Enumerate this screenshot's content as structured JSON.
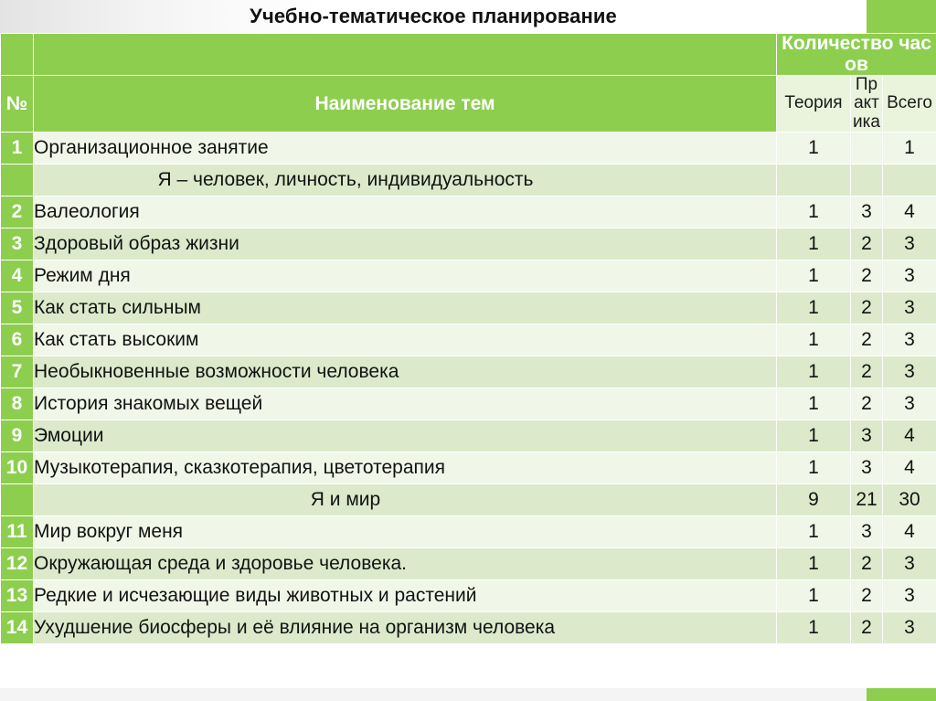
{
  "title": "Учебно-тематическое планирование",
  "table": {
    "headers": {
      "num": "№",
      "name": "Наименование тем",
      "qty_group": "Количество часов",
      "theory": "Теория",
      "practice": "Практика",
      "total": "Всего"
    },
    "rows": [
      {
        "kind": "data",
        "num": "1",
        "name": "Организационное занятие",
        "theory": "1",
        "practice": "",
        "total": "1"
      },
      {
        "kind": "section",
        "num": "",
        "name": "Я – человек, личность, индивидуальность",
        "theory": "",
        "practice": "",
        "total": ""
      },
      {
        "kind": "data",
        "num": "2",
        "name": "Валеология",
        "theory": "1",
        "practice": "3",
        "total": "4"
      },
      {
        "kind": "data",
        "num": "3",
        "name": "Здоровый образ жизни",
        "theory": "1",
        "practice": "2",
        "total": "3"
      },
      {
        "kind": "data",
        "num": "4",
        "name": "Режим дня",
        "theory": "1",
        "practice": "2",
        "total": "3"
      },
      {
        "kind": "data",
        "num": "5",
        "name": "Как стать сильным",
        "theory": "1",
        "practice": "2",
        "total": "3"
      },
      {
        "kind": "data",
        "num": "6",
        "name": "Как стать  высоким",
        "theory": "1",
        "practice": "2",
        "total": "3"
      },
      {
        "kind": "data",
        "num": "7",
        "name": "Необыкновенные возможности человека",
        "theory": "1",
        "practice": "2",
        "total": "3"
      },
      {
        "kind": "data",
        "num": "8",
        "name": "История знакомых вещей",
        "theory": "1",
        "practice": "2",
        "total": "3"
      },
      {
        "kind": "data",
        "num": "9",
        "name": "Эмоции",
        "theory": "1",
        "practice": "3",
        "total": "4"
      },
      {
        "kind": "data",
        "num": "10",
        "name": "Музыкотерапия, сказкотерапия, цветотерапия",
        "theory": "1",
        "practice": "3",
        "total": "4"
      },
      {
        "kind": "section",
        "num": "",
        "name": "Я и мир",
        "theory": "9",
        "practice": "21",
        "total": "30"
      },
      {
        "kind": "data",
        "num": "11",
        "name": "Мир вокруг меня",
        "theory": "1",
        "practice": "3",
        "total": "4"
      },
      {
        "kind": "data",
        "num": "12",
        "name": "Окружающая среда и здоровье человека.",
        "theory": "1",
        "practice": "2",
        "total": "3"
      },
      {
        "kind": "data",
        "num": "13",
        "name": "Редкие и исчезающие виды животных и растений",
        "theory": "1",
        "practice": "2",
        "total": "3"
      },
      {
        "kind": "data",
        "num": "14",
        "name": "Ухудшение биосферы и её влияние на организм человека",
        "theory": "1",
        "practice": "2",
        "total": "3"
      }
    ]
  },
  "colors": {
    "accent_green": "#8dce4f",
    "row_light": "#f1f7e8",
    "row_dark": "#dceacb",
    "subheader_bg": "#eaf4dd"
  }
}
